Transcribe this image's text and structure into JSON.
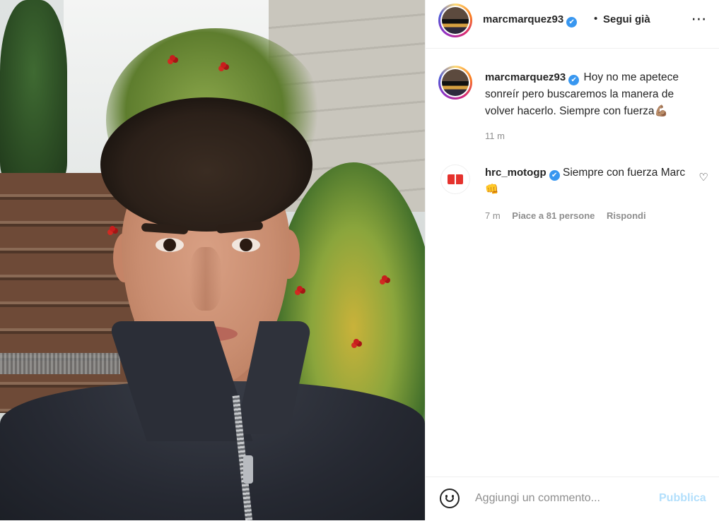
{
  "post": {
    "author": "marcmarquez93",
    "follow_separator": "•",
    "follow_status": "Segui già",
    "more_icon": "⋯",
    "caption_text": "Hoy no me apetece sonreír pero buscaremos la manera de volver hacerlo. Siempre con fuerza💪🏽",
    "caption_time": "11 m",
    "verified_glyph": "✔",
    "photo_alt": "Selfie"
  },
  "comment": {
    "author": "hrc_motogp",
    "text": "Siempre con fuerza Marc 👊",
    "time": "7 m",
    "likes": "Piace a 81 persone",
    "reply_label": "Rispondi",
    "heart_glyph": "♡"
  },
  "footer": {
    "placeholder": "Aggiungi un commento...",
    "publish_label": "Pubblica"
  },
  "colors": {
    "verified": "#3897f0",
    "publish_disabled": "#b2dffc",
    "secondary_text": "#8e8e8e"
  }
}
